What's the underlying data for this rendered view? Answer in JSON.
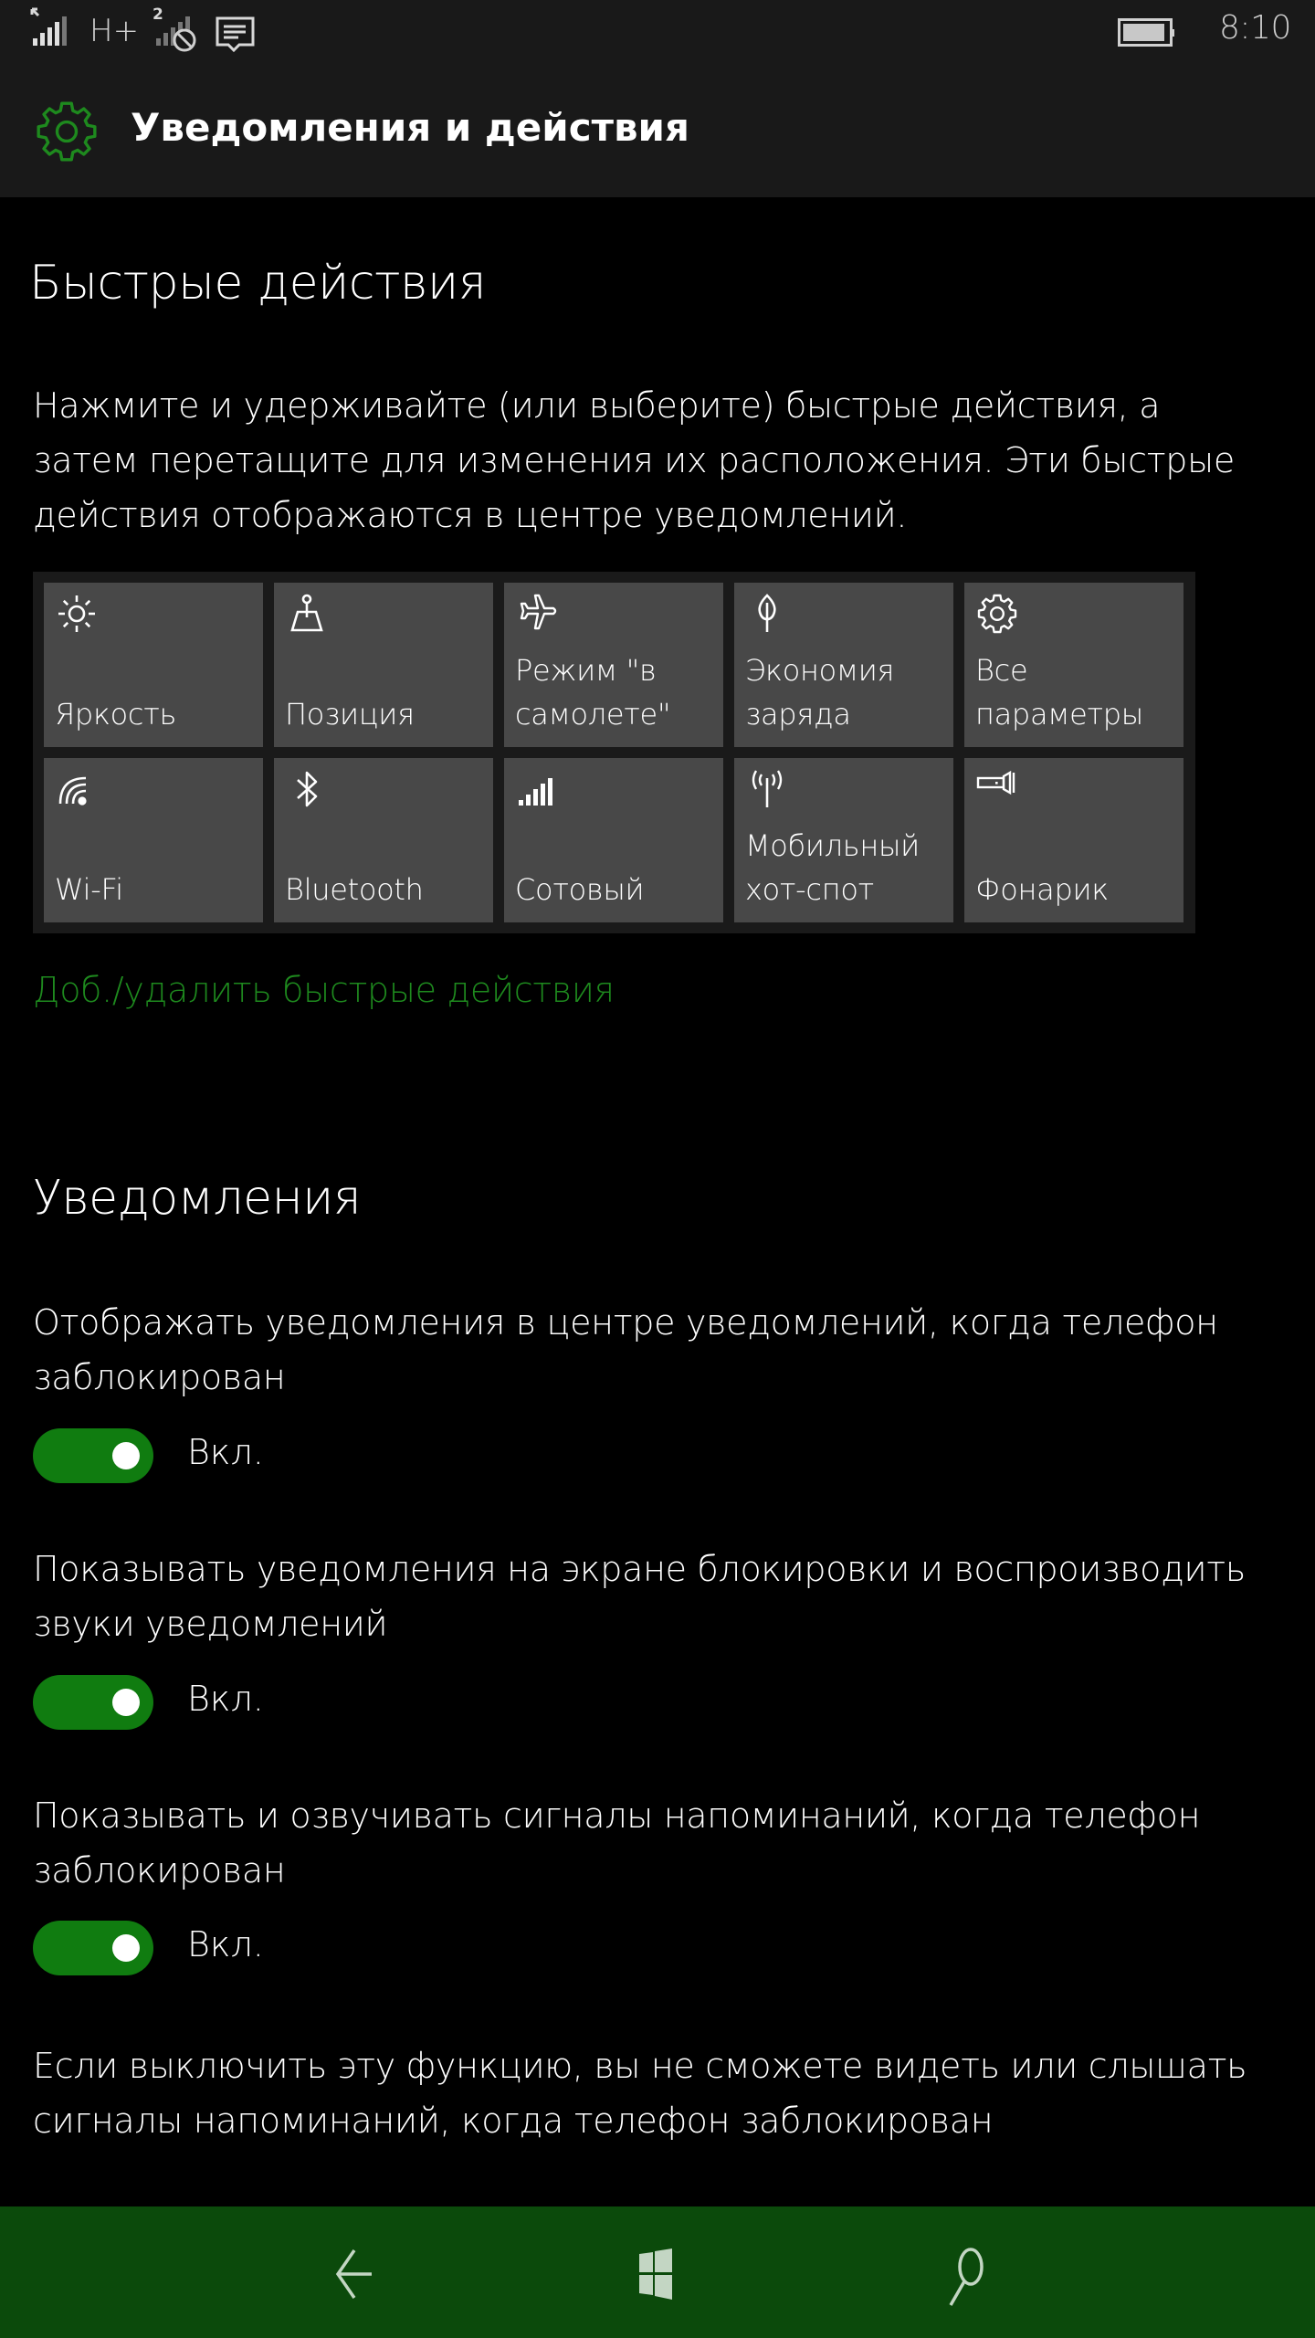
{
  "status_bar": {
    "network_type": "H+",
    "sim2_label": "2",
    "time": "8:10",
    "icons": [
      "signal-sim1-icon",
      "data-arrow-icon",
      "signal-sim2-disabled-icon",
      "message-icon",
      "battery-icon"
    ]
  },
  "header": {
    "icon": "gear-icon",
    "title": "Уведомления и действия"
  },
  "quick_actions": {
    "title": "Быстрые действия",
    "description": "Нажмите и удерживайте (или выберите) быстрые действия, а затем перетащите для изменения их расположения. Эти быстрые действия отображаются в центре уведомлений.",
    "tiles": [
      {
        "icon": "brightness-icon",
        "label": "Яркость"
      },
      {
        "icon": "location-icon",
        "label": "Позиция"
      },
      {
        "icon": "airplane-icon",
        "label": "Режим \"в самолете\""
      },
      {
        "icon": "battery-saver-icon",
        "label": "Экономия заряда"
      },
      {
        "icon": "settings-icon",
        "label": "Все параметры"
      },
      {
        "icon": "wifi-icon",
        "label": "Wi-Fi"
      },
      {
        "icon": "bluetooth-icon",
        "label": "Bluetooth"
      },
      {
        "icon": "cellular-icon",
        "label": "Сотовый"
      },
      {
        "icon": "hotspot-icon",
        "label": "Мобильный хот-спот"
      },
      {
        "icon": "flashlight-icon",
        "label": "Фонарик"
      }
    ],
    "link": "Доб./удалить быстрые действия"
  },
  "notifications": {
    "title": "Уведомления",
    "settings": [
      {
        "label": "Отображать уведомления в центре уведомлений, когда телефон заблокирован",
        "state": "Вкл.",
        "on": true
      },
      {
        "label": "Показывать уведомления на экране блокировки и воспроизводить звуки уведомлений",
        "state": "Вкл.",
        "on": true
      },
      {
        "label": "Показывать и озвучивать сигналы напоминаний, когда телефон заблокирован",
        "state": "Вкл.",
        "on": true
      }
    ],
    "footnote": "Если выключить эту функцию, вы не сможете видеть или слышать сигналы напоминаний, когда телефон заблокирован"
  },
  "navbar": {
    "buttons": [
      {
        "name": "back",
        "icon": "back-arrow-icon"
      },
      {
        "name": "start",
        "icon": "windows-logo-icon"
      },
      {
        "name": "search",
        "icon": "search-icon"
      }
    ]
  },
  "colors": {
    "accent": "#107c10",
    "link": "#1e8a1e",
    "header_bg": "#191919",
    "tile_bg": "#484848",
    "navbar_bg": "#0b4a0b"
  }
}
